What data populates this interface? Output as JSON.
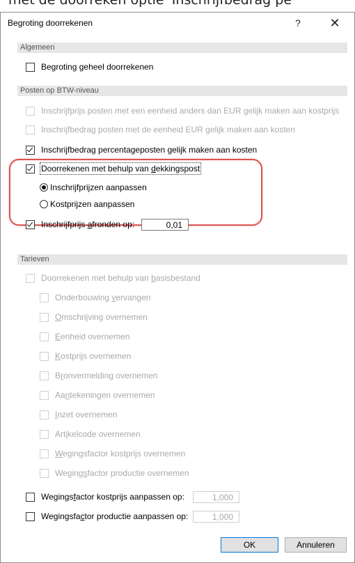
{
  "background_text": "met de doorreken optie 'Inschrijfbedrag pe",
  "window": {
    "title": "Begroting doorrekenen",
    "help_glyph": "?",
    "close_glyph": "✕"
  },
  "sections": {
    "algemeen": "Algemeen",
    "posten": "Posten op BTW-niveau",
    "tarieven": "Tarieven"
  },
  "algemeen": {
    "geheel": {
      "pre": "Begroting ",
      "u": "g",
      "post": "eheel doorrekenen",
      "checked": false
    }
  },
  "posten": {
    "inschrijfprijs_eur": "Inschrijfprijs posten met een eenheid anders dan EUR gelijk maken aan kostprijs",
    "inschrijfbedrag_eur": "Inschrijfbedrag posten met de eenheid EUR gelijk maken aan kosten",
    "percentageposten": "Inschrijfbedrag percentageposten gelijk maken aan kosten",
    "dekkingspost": {
      "pre": "Doorrekenen met behulp van ",
      "u": "d",
      "post": "ekkingspost"
    },
    "radio_inschrijf": "Inschrijfprijzen aanpassen",
    "radio_kost": "Kostprijzen aanpassen",
    "afronden": {
      "pre": "Inschrijfprijs ",
      "u": "a",
      "post": "fronden op:"
    },
    "afronden_value": "0,01"
  },
  "tarieven": {
    "basisbestand": {
      "pre": "Doorrekenen met behulp van ",
      "u": "b",
      "post": "asisbestand"
    },
    "items": [
      {
        "pre": "Onderbouwing ",
        "u": "v",
        "post": "ervangen"
      },
      {
        "pre": "",
        "u": "O",
        "post": "mschrijving overnemen"
      },
      {
        "pre": "",
        "u": "E",
        "post": "enheid overnemen"
      },
      {
        "pre": "",
        "u": "K",
        "post": "ostprijs overnemen"
      },
      {
        "pre": "B",
        "u": "r",
        "post": "onvermelding overnemen"
      },
      {
        "pre": "Aa",
        "u": "n",
        "post": "tekeningen overnemen"
      },
      {
        "pre": "",
        "u": "I",
        "post": "nzet overnemen"
      },
      {
        "pre": "Art",
        "u": "i",
        "post": "kelcode overnemen"
      },
      {
        "pre": "",
        "u": "W",
        "post": "egingsfactor kostprijs overnemen"
      },
      {
        "pre": "Weging",
        "u": "s",
        "post": "factor productie overnemen"
      }
    ],
    "kostprijs_aanpassen": {
      "pre": "Wegings",
      "u": "f",
      "post": "actor kostprijs aanpassen op:",
      "value": "1,000"
    },
    "productie_aanpassen": {
      "pre": "Wegingsfa",
      "u": "c",
      "post": "tor productie aanpassen op:",
      "value": "1,000"
    }
  },
  "buttons": {
    "ok": "OK",
    "cancel": "Annuleren"
  },
  "colors": {
    "highlight": "#d9534f",
    "section_bg": "#e6e6e6",
    "disabled_text": "#a9a9a9",
    "default_button_border": "#0078d7"
  }
}
